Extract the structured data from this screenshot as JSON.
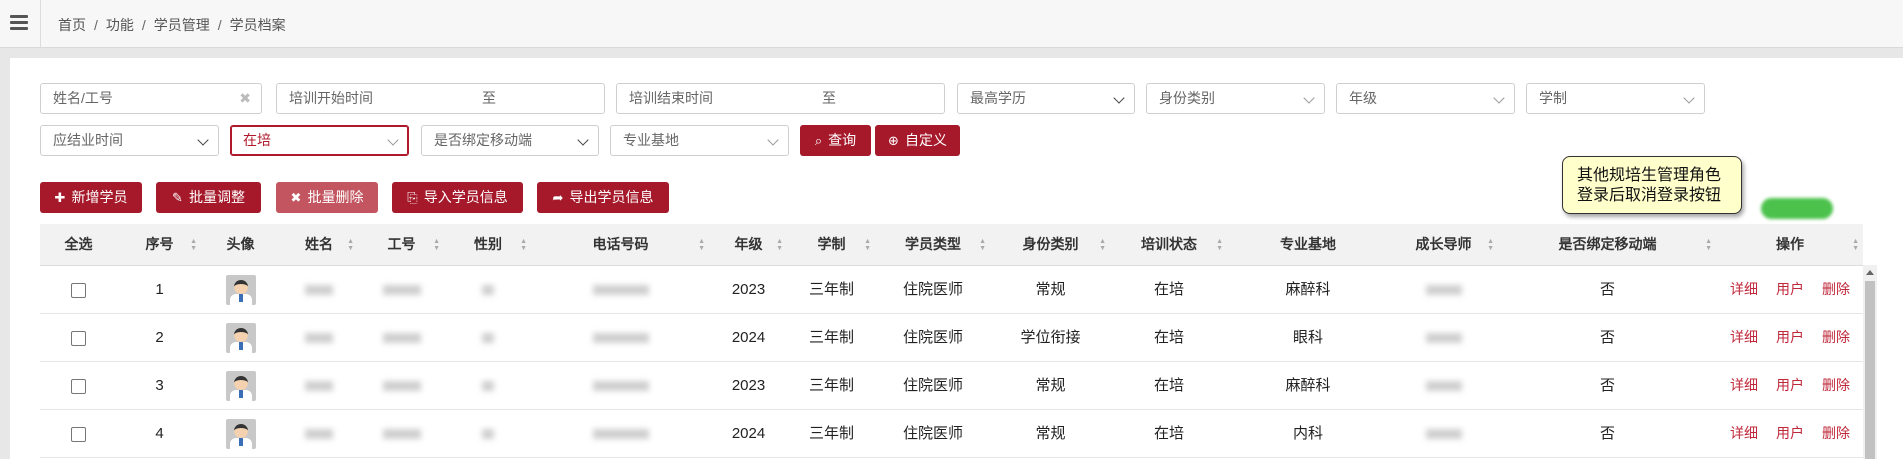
{
  "topbar": {
    "menu_icon": "hamburger-icon",
    "breadcrumb": [
      "首页",
      "功能",
      "学员管理",
      "学员档案"
    ],
    "separator": "/"
  },
  "filters": {
    "name_placeholder": "姓名/工号",
    "clear_glyph": "✖",
    "train_start_placeholder": "培训开始时间",
    "train_end_placeholder": "培训结束时间",
    "range_sep": "至",
    "education": "最高学历",
    "identity_type": "身份类别",
    "grade": "年级",
    "schooling": "学制",
    "graduation_time": "应结业时间",
    "training_status": "在培",
    "bind_mobile": "是否绑定移动端",
    "base": "专业基地",
    "search_label": "查询",
    "custom_label": "自定义"
  },
  "actions": {
    "add": "新增学员",
    "batch_adjust": "批量调整",
    "batch_delete": "批量删除",
    "import": "导入学员信息",
    "export": "导出学员信息"
  },
  "tooltip": [
    "其他规培生管理角色",
    "登录后取消登录按钮"
  ],
  "colors": {
    "primary": "#a5192b",
    "primary_light": "#c25560",
    "link": "#c0283a",
    "tooltip_bg": "#ffffcc",
    "toggle": "#4cc24c"
  },
  "table": {
    "headers": [
      "全选",
      "序号",
      "头像",
      "姓名",
      "工号",
      "性别",
      "电话号码",
      "年级",
      "学制",
      "学员类型",
      "身份类别",
      "培训状态",
      "专业基地",
      "成长导师",
      "是否绑定移动端",
      "操作"
    ],
    "rows": [
      {
        "no": "1",
        "grade": "2023",
        "schooling": "三年制",
        "student_type": "住院医师",
        "identity": "常规",
        "status": "在培",
        "base": "麻醉科",
        "bound": "否"
      },
      {
        "no": "2",
        "grade": "2024",
        "schooling": "三年制",
        "student_type": "住院医师",
        "identity": "学位衔接",
        "status": "在培",
        "base": "眼科",
        "bound": "否"
      },
      {
        "no": "3",
        "grade": "2023",
        "schooling": "三年制",
        "student_type": "住院医师",
        "identity": "常规",
        "status": "在培",
        "base": "麻醉科",
        "bound": "否"
      },
      {
        "no": "4",
        "grade": "2024",
        "schooling": "三年制",
        "student_type": "住院医师",
        "identity": "常规",
        "status": "在培",
        "base": "内科",
        "bound": "否"
      }
    ],
    "row_ops": [
      "详细",
      "用户",
      "删除"
    ]
  }
}
